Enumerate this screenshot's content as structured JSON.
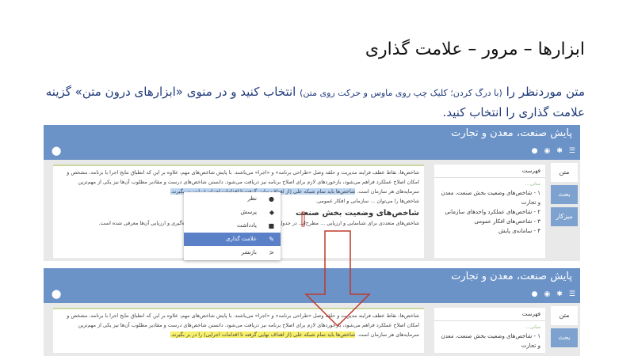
{
  "slide": {
    "title": "ابزارها – مرور – علامت گذاری",
    "instruction_a": "متن موردنظر را ",
    "instruction_small": "(با درگ کردن؛ کلیک چپ روی ماوس و حرکت روی متن)",
    "instruction_b": " انتخاب کنید و در منوی «ابزارهای درون متن» گزینه علامت گذاری را انتخاب کنید."
  },
  "screenshot_top": {
    "app_title": "پایش صنعت، معدن و تجارت",
    "sidebar": [
      "متن",
      "بحث",
      "میزکار"
    ],
    "toc_header": "فهرست",
    "toc_sub": "مبانی...",
    "toc_items": [
      "۱ - شاخص‌های وضعیت بخش صنعت، معدن و تجارت",
      "۲ - شاخص‌های عملکرد واحدهای سازمانی",
      "۳ - شاخص‌های افکار عمومی",
      "۴ - سامانه‌ی پایش"
    ],
    "content_p1": "شاخص‌ها، نقاط عطف فرایند مدیریت و حلقه وصل «طراحی برنامه» و «اجرا» می‌باشند. با پایش شاخص‌های مهم، علاوه بر این که انطباق نتایج اجرا با برنامه، مشخص و امکان اصلاح عملکرد فراهم می‌شود، بازخوردهای لازم برای اصلاح برنامه نیز دریافت می‌شود. دانستن شاخص‌های درست و مقادیر مطلوب آن‌ها نیز یکی از مهم‌ترین سرمایه‌های هر سازمان است.",
    "content_highlight": "شاخص‌ها باید تمام شبکه علی (از اهداف نهایی گرفته تا اقدامات اجرایی) را در بر بگیرند.",
    "content_p2": "شاخص‌ها را می‌توان ... سازمانی و افکار عمومی.",
    "content_heading": "شاخص‌های وضعیت بخش صنعت",
    "content_p3": "شاخص‌های متعددی برای شناسایی و ارزیابی ... مطرح‌اند. در جدول ۱، برخی از شاخص‌های مهم و دوره‌های اندازه‌گیری و ارزیابی آن‌ها معرفی شده است.",
    "context_menu": [
      {
        "label": "نظر",
        "icon": "comment-icon"
      },
      {
        "label": "پرسش",
        "icon": "question-icon"
      },
      {
        "label": "یادداشت",
        "icon": "note-icon"
      },
      {
        "label": "علامت گذاری",
        "icon": "pencil-icon"
      },
      {
        "label": "بازنشر",
        "icon": "share-icon"
      }
    ],
    "selected_menu_item": "علامت گذاری"
  },
  "screenshot_bottom": {
    "app_title": "پایش صنعت، معدن و تجارت",
    "sidebar": [
      "متن",
      "بحث"
    ],
    "toc_header": "فهرست",
    "toc_sub": "مبانی...",
    "toc_items": [
      "۱ - شاخص‌های وضعیت بخش صنعت، معدن و تجارت"
    ],
    "content_p1": "شاخص‌ها، نقاط عطف فرایند مدیریت و حلقه وصل «طراحی برنامه» و «اجرا» می‌باشند. با پایش شاخص‌های مهم، علاوه بر این که انطباق نتایج اجرا با برنامه، مشخص و امکان اصلاح عملکرد فراهم می‌شود، بازخوردهای لازم برای اصلاح برنامه نیز دریافت می‌شود. دانستن شاخص‌های درست و مقادیر مطلوب آن‌ها نیز یکی از مهم‌ترین سرمایه‌های هر سازمان است.",
    "content_highlight": "شاخص‌ها باید تمام شبکه علی (از اهداف نهایی گرفته تا اقدامات اجرایی) را در بر بگیرند."
  },
  "colors": {
    "bar": "#6b93c8",
    "selected": "#5a80c8",
    "arrow": "#c0392b",
    "highlight": "#f7f06a"
  }
}
